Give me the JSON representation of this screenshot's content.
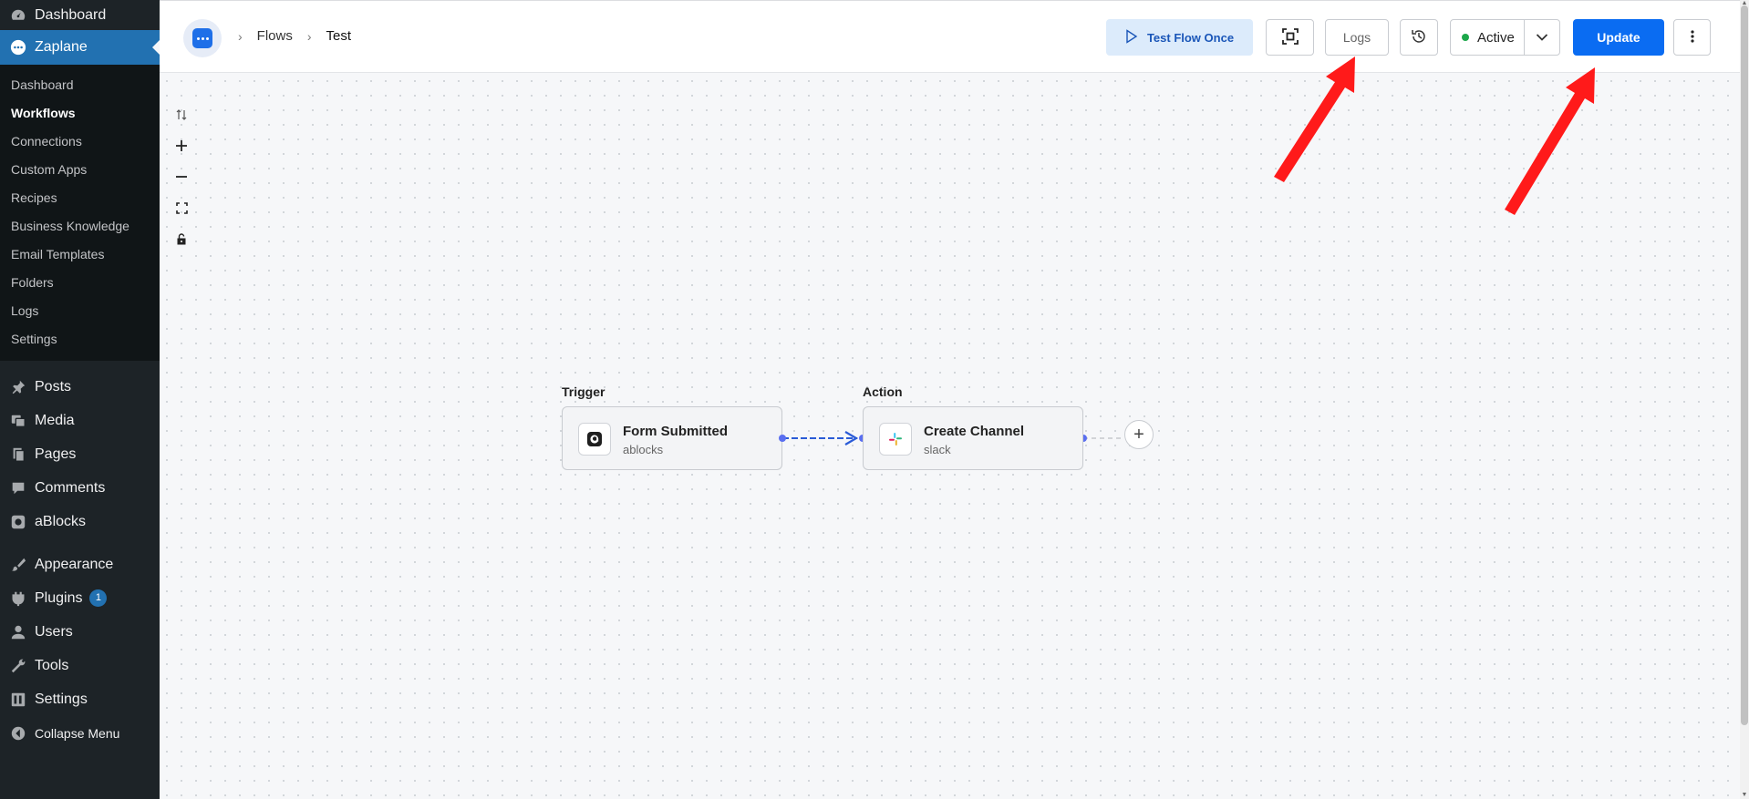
{
  "sidebar": {
    "dashboard": "Dashboard",
    "zaplane": "Zaplane",
    "submenu": [
      "Dashboard",
      "Workflows",
      "Connections",
      "Custom Apps",
      "Recipes",
      "Business Knowledge",
      "Email Templates",
      "Folders",
      "Logs",
      "Settings"
    ],
    "posts": "Posts",
    "media": "Media",
    "pages": "Pages",
    "comments": "Comments",
    "ablocks": "aBlocks",
    "appearance": "Appearance",
    "plugins": "Plugins",
    "plugins_badge": "1",
    "users": "Users",
    "tools": "Tools",
    "settings": "Settings",
    "collapse": "Collapse Menu"
  },
  "header": {
    "breadcrumb_flows": "Flows",
    "breadcrumb_current": "Test",
    "test_flow_label": "Test Flow Once",
    "logs_label": "Logs",
    "status_label": "Active",
    "update_label": "Update"
  },
  "canvas": {
    "trigger_label": "Trigger",
    "action_label": "Action",
    "trigger_node": {
      "title": "Form Submitted",
      "subtitle": "ablocks"
    },
    "action_node": {
      "title": "Create Channel",
      "subtitle": "slack"
    },
    "add_symbol": "+"
  },
  "colors": {
    "wp_sidebar": "#1d2327",
    "wp_accent": "#2271b1",
    "update_button": "#0a6cf2",
    "status_active": "#1ca74a",
    "connector": "#2a5bd7",
    "annotation_arrow": "#ff1a1a"
  },
  "icons": [
    "dashboard-icon",
    "zaplane-icon",
    "pin-icon",
    "media-icon",
    "pages-icon",
    "comment-icon",
    "ablocks-icon",
    "brush-icon",
    "plug-icon",
    "user-icon",
    "wrench-icon",
    "settings-icon",
    "collapse-icon",
    "play-icon",
    "focus-icon",
    "history-icon",
    "chevron-down-icon",
    "more-vertical-icon",
    "zoom-in-icon",
    "zoom-out-icon",
    "fit-view-icon",
    "lock-icon",
    "swap-icon",
    "slack-icon"
  ]
}
